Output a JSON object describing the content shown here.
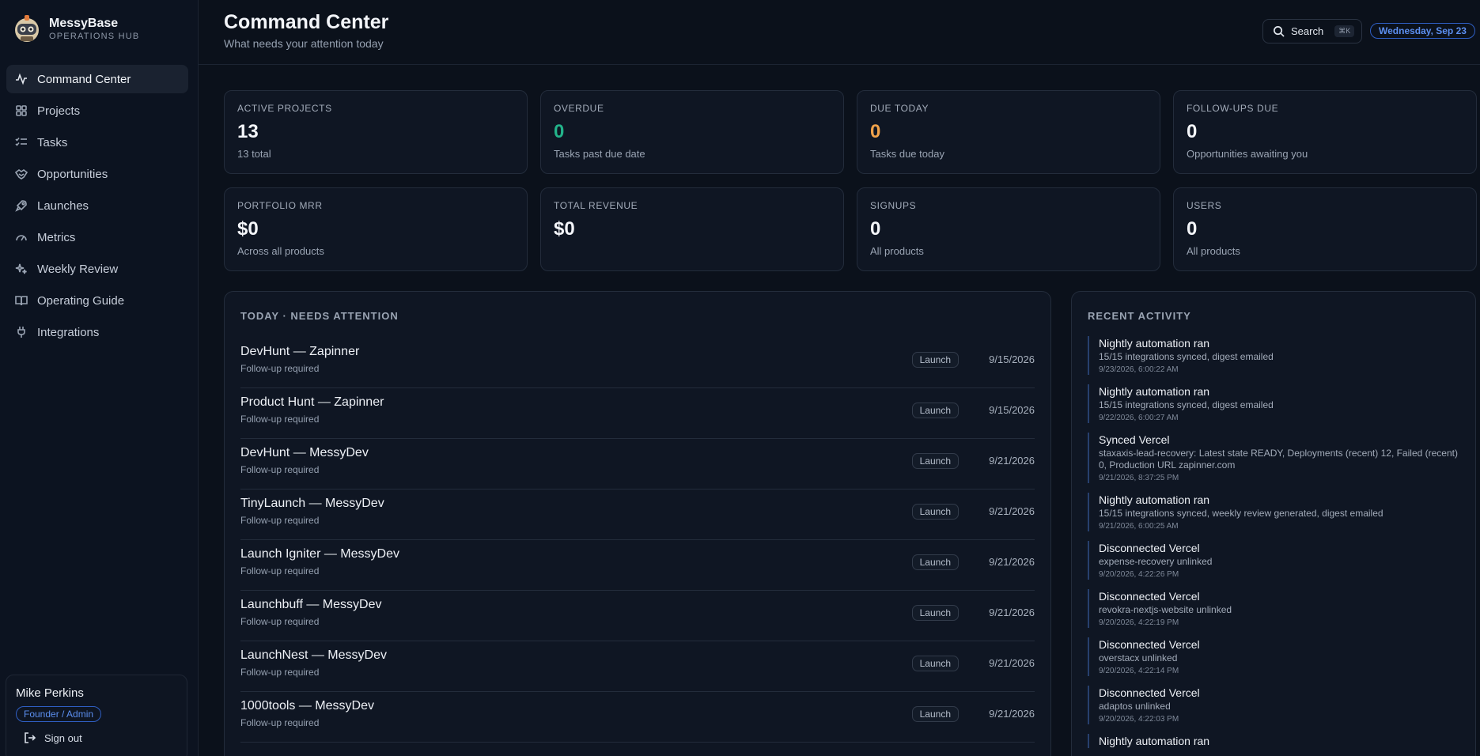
{
  "brand": {
    "name": "MessyBase",
    "subtitle": "OPERATIONS HUB"
  },
  "sidebar": {
    "items": [
      {
        "label": "Command Center",
        "icon": "activity-icon",
        "active": true
      },
      {
        "label": "Projects",
        "icon": "grid-icon",
        "active": false
      },
      {
        "label": "Tasks",
        "icon": "list-check-icon",
        "active": false
      },
      {
        "label": "Opportunities",
        "icon": "handshake-icon",
        "active": false
      },
      {
        "label": "Launches",
        "icon": "rocket-icon",
        "active": false
      },
      {
        "label": "Metrics",
        "icon": "gauge-icon",
        "active": false
      },
      {
        "label": "Weekly Review",
        "icon": "sparkles-icon",
        "active": false
      },
      {
        "label": "Operating Guide",
        "icon": "book-icon",
        "active": false
      },
      {
        "label": "Integrations",
        "icon": "plug-icon",
        "active": false
      }
    ]
  },
  "user": {
    "name": "Mike Perkins",
    "role": "Founder / Admin",
    "signout_label": "Sign out"
  },
  "header": {
    "title": "Command Center",
    "subtitle": "What needs your attention today",
    "search_label": "Search",
    "search_shortcut": "⌘K",
    "date": "Wednesday, Sep 23"
  },
  "stats": [
    {
      "label": "ACTIVE PROJECTS",
      "value": "13",
      "desc": "13 total",
      "tone": "default"
    },
    {
      "label": "OVERDUE",
      "value": "0",
      "desc": "Tasks past due date",
      "tone": "green"
    },
    {
      "label": "DUE TODAY",
      "value": "0",
      "desc": "Tasks due today",
      "tone": "orange"
    },
    {
      "label": "FOLLOW-UPS DUE",
      "value": "0",
      "desc": "Opportunities awaiting you",
      "tone": "default"
    },
    {
      "label": "PORTFOLIO MRR",
      "value": "$0",
      "desc": "Across all products",
      "tone": "default"
    },
    {
      "label": "TOTAL REVENUE",
      "value": "$0",
      "desc": "",
      "tone": "default"
    },
    {
      "label": "SIGNUPS",
      "value": "0",
      "desc": "All products",
      "tone": "default"
    },
    {
      "label": "USERS",
      "value": "0",
      "desc": "All products",
      "tone": "default"
    }
  ],
  "attention": {
    "title": "TODAY · NEEDS ATTENTION",
    "items": [
      {
        "title": "DevHunt — Zapinner",
        "sub": "Follow-up required",
        "tag": "Launch",
        "date": "9/15/2026"
      },
      {
        "title": "Product Hunt — Zapinner",
        "sub": "Follow-up required",
        "tag": "Launch",
        "date": "9/15/2026"
      },
      {
        "title": "DevHunt — MessyDev",
        "sub": "Follow-up required",
        "tag": "Launch",
        "date": "9/21/2026"
      },
      {
        "title": "TinyLaunch — MessyDev",
        "sub": "Follow-up required",
        "tag": "Launch",
        "date": "9/21/2026"
      },
      {
        "title": "Launch Igniter — MessyDev",
        "sub": "Follow-up required",
        "tag": "Launch",
        "date": "9/21/2026"
      },
      {
        "title": "Launchbuff — MessyDev",
        "sub": "Follow-up required",
        "tag": "Launch",
        "date": "9/21/2026"
      },
      {
        "title": "LaunchNest — MessyDev",
        "sub": "Follow-up required",
        "tag": "Launch",
        "date": "9/21/2026"
      },
      {
        "title": "1000tools — MessyDev",
        "sub": "Follow-up required",
        "tag": "Launch",
        "date": "9/21/2026"
      }
    ]
  },
  "activity": {
    "title": "RECENT ACTIVITY",
    "items": [
      {
        "title": "Nightly automation ran",
        "desc": "15/15 integrations synced, digest emailed",
        "time": "9/23/2026, 6:00:22 AM"
      },
      {
        "title": "Nightly automation ran",
        "desc": "15/15 integrations synced, digest emailed",
        "time": "9/22/2026, 6:00:27 AM"
      },
      {
        "title": "Synced Vercel",
        "desc": "staxaxis-lead-recovery: Latest state READY, Deployments (recent) 12, Failed (recent) 0, Production URL zapinner.com",
        "time": "9/21/2026, 8:37:25 PM"
      },
      {
        "title": "Nightly automation ran",
        "desc": "15/15 integrations synced, weekly review generated, digest emailed",
        "time": "9/21/2026, 6:00:25 AM"
      },
      {
        "title": "Disconnected Vercel",
        "desc": "expense-recovery unlinked",
        "time": "9/20/2026, 4:22:26 PM"
      },
      {
        "title": "Disconnected Vercel",
        "desc": "revokra-nextjs-website unlinked",
        "time": "9/20/2026, 4:22:19 PM"
      },
      {
        "title": "Disconnected Vercel",
        "desc": "overstacx unlinked",
        "time": "9/20/2026, 4:22:14 PM"
      },
      {
        "title": "Disconnected Vercel",
        "desc": "adaptos unlinked",
        "time": "9/20/2026, 4:22:03 PM"
      },
      {
        "title": "Nightly automation ran",
        "desc": "",
        "time": ""
      }
    ]
  },
  "colors": {
    "accent": "#5c8ff0",
    "green": "#23b38a",
    "orange": "#f0a24a",
    "background": "#0b111b"
  }
}
